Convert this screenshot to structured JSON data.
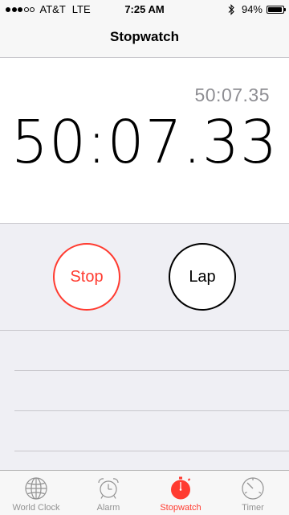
{
  "status_bar": {
    "carrier": "AT&T",
    "network": "LTE",
    "time": "7:25 AM",
    "battery_percent": "94%",
    "battery_level": 0.94,
    "signal_bars_filled": 3,
    "signal_bars_total": 5
  },
  "nav": {
    "title": "Stopwatch"
  },
  "timer": {
    "lap_time": "50:07.35",
    "main_time": "50:07.33"
  },
  "controls": {
    "stop_label": "Stop",
    "lap_label": "Lap"
  },
  "tabs": [
    {
      "label": "World Clock",
      "icon": "globe-icon",
      "active": false
    },
    {
      "label": "Alarm",
      "icon": "alarm-clock-icon",
      "active": false
    },
    {
      "label": "Stopwatch",
      "icon": "stopwatch-icon",
      "active": true
    },
    {
      "label": "Timer",
      "icon": "timer-icon",
      "active": false
    }
  ],
  "colors": {
    "accent": "#ff3b30",
    "inactive_tab": "#929292",
    "secondary_text": "#8e8e93"
  }
}
